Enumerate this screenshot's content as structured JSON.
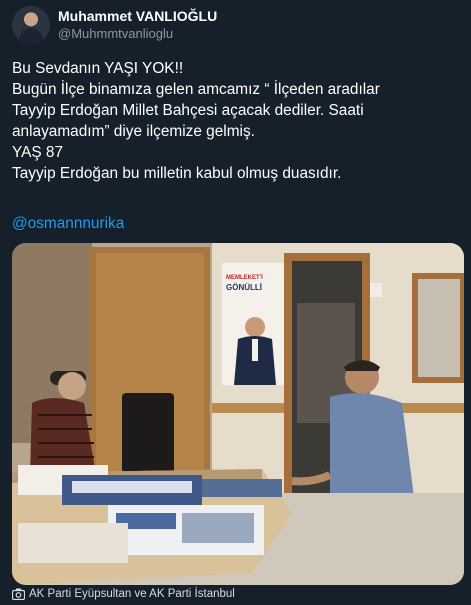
{
  "author": {
    "name": "Muhammet VANLIOĞLU",
    "handle": "@Muhmmtvanlioglu"
  },
  "tweet": {
    "lines": [
      "Bu Sevdanın YAŞI YOK!!",
      "Bugün İlçe binamıza gelen amcamız “ İlçeden aradılar",
      "Tayyip Erdoğan Millet Bahçesi açacak dediler. Saati",
      "anlayamadım” diye ilçemize gelmiş.",
      "YAŞ 87",
      "Tayyip Erdoğan bu milletin kabul olmuş duasıdır."
    ],
    "mention": "@osmannnurika"
  },
  "photo": {
    "poster_line1": "MEMLEKET'İ",
    "poster_line2": "GÖNÜLLİ",
    "credit": "AK Parti Eyüpsultan ve AK Parti İstanbul"
  },
  "colors": {
    "background": "#15202b",
    "text": "#ffffff",
    "secondary": "#8899a6",
    "link": "#1d9bf0"
  }
}
